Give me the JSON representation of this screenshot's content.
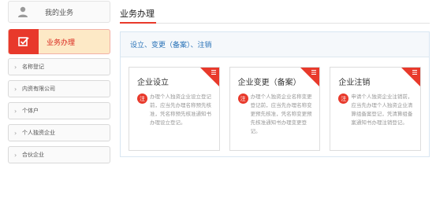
{
  "sidebar": {
    "user_label": "我的业务",
    "active_label": "业务办理",
    "items": [
      {
        "label": "名称登记"
      },
      {
        "label": "内资有限公司"
      },
      {
        "label": "个体户"
      },
      {
        "label": "个人独资企业"
      },
      {
        "label": "合伙企业"
      }
    ]
  },
  "main": {
    "title": "业务办理",
    "panel_title": "设立、变更（备案）、注销",
    "cards": [
      {
        "title": "企业设立",
        "badge": "注",
        "desc": "办理个人独资企业设立登记前，应当先办理名称预先核准，凭名称预先核准通知书办理设立登记。"
      },
      {
        "title": "企业变更（备案）",
        "badge": "注",
        "desc": "办理个人独资企业名称变更登记前，应当先办理名称变更预先核准，凭名称变更预先核准通知书办理变更登记。"
      },
      {
        "title": "企业注销",
        "badge": "注",
        "desc": "申请个人独资企业注销前，应当先办理个人独资企业清算组备案登记，凭清算组备案通知书办理注销登记。"
      }
    ]
  },
  "colors": {
    "accent_red": "#e8392b",
    "active_bg": "#fde9c6",
    "link_blue": "#2a73b8"
  },
  "icons": {
    "user": "user-icon",
    "edit": "edit-checkbox-icon",
    "chevron": "chevron-right-icon",
    "corner": "menu-lines-icon"
  }
}
